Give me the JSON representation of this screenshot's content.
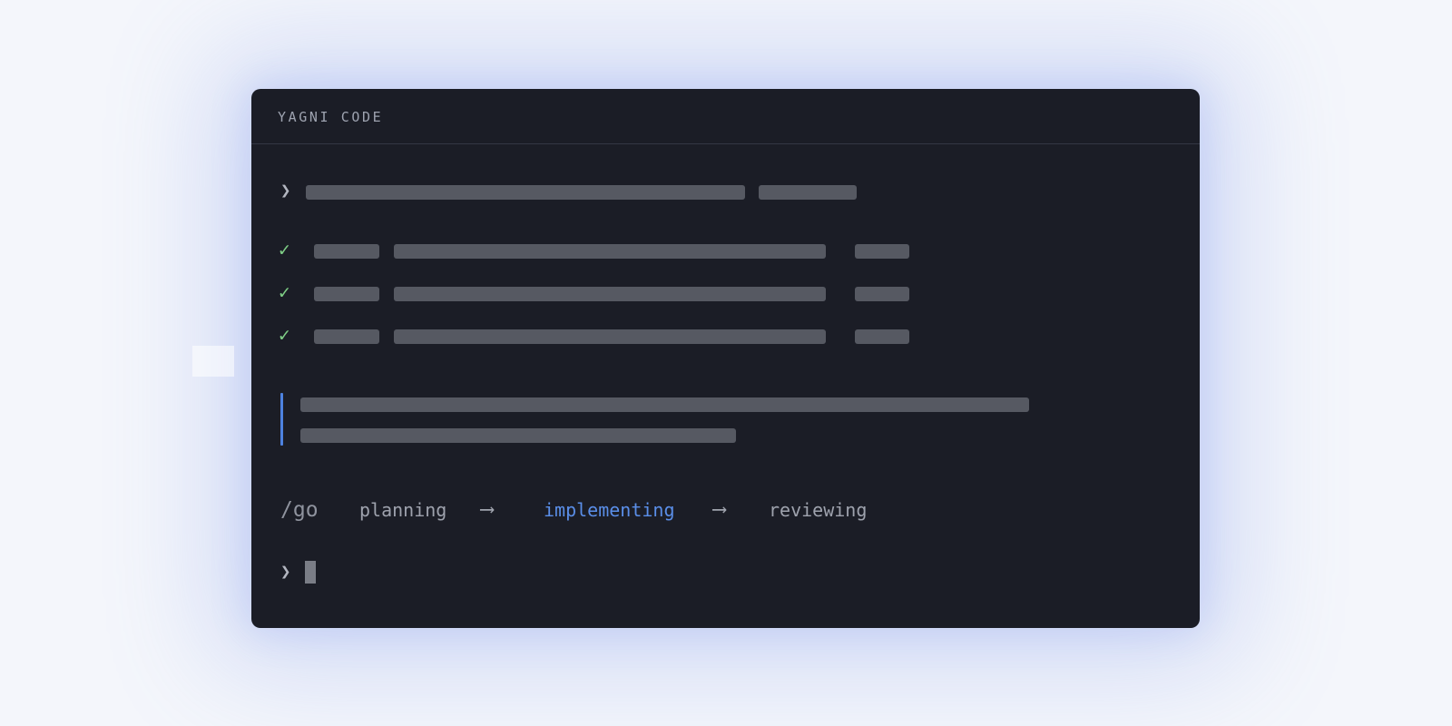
{
  "window": {
    "title": "YAGNI CODE"
  },
  "prompt": {
    "glyph": "❯"
  },
  "tasks": [
    {
      "status_icon": "✓",
      "state": "done"
    },
    {
      "status_icon": "✓",
      "state": "done"
    },
    {
      "status_icon": "✓",
      "state": "done"
    }
  ],
  "pipeline": {
    "command": "/go",
    "stages": [
      "planning",
      "implementing",
      "reviewing"
    ],
    "active_stage": "implementing",
    "arrow": "⟶"
  },
  "input_prompt": {
    "glyph": "❯"
  },
  "colors": {
    "background": "#f4f6fb",
    "terminal_bg": "#1b1d26",
    "placeholder_bar": "#565962",
    "success": "#7fcf86",
    "accent": "#5a8ee8",
    "quote_rule": "#4d82e0",
    "muted_text": "#9ea2ad"
  },
  "icons": {
    "prompt": "chevron-right-icon",
    "task_status": "checkmark-icon",
    "pipeline_arrow": "long-arrow-right-icon"
  }
}
